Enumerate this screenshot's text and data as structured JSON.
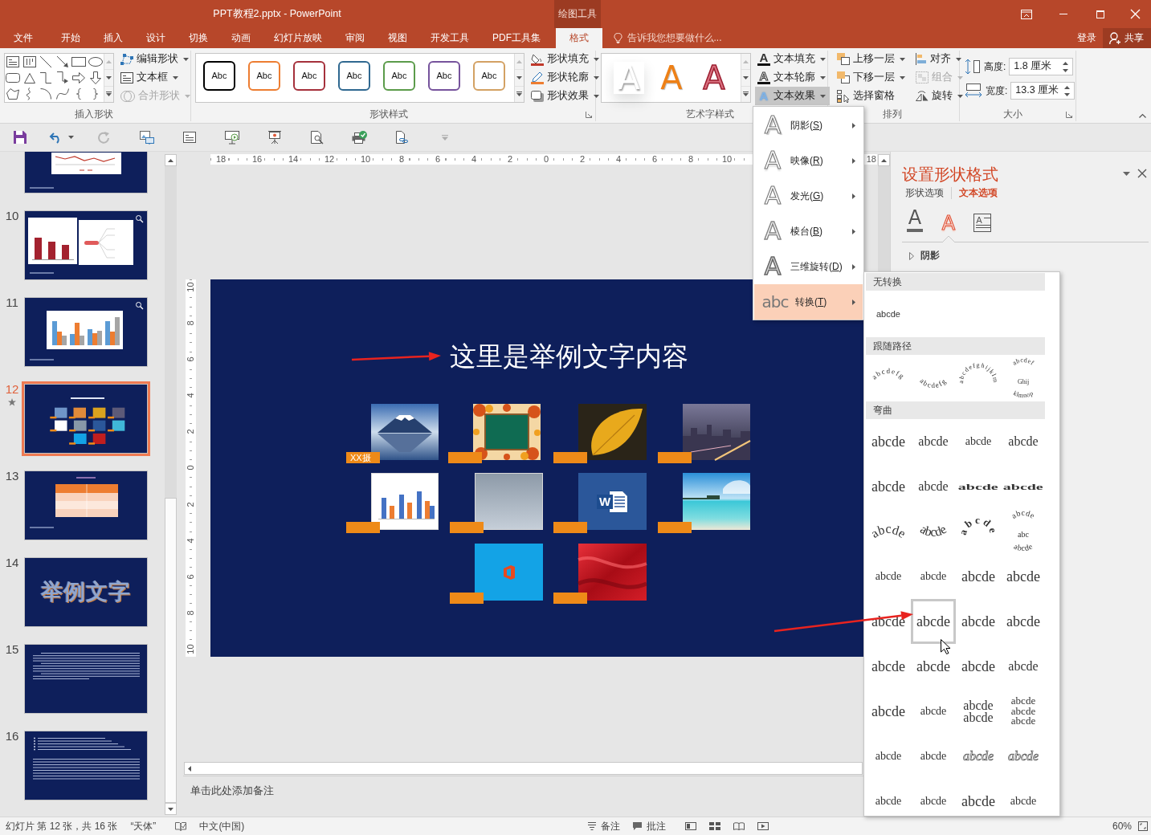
{
  "window": {
    "title": "PPT教程2.pptx - PowerPoint",
    "context_group": "绘图工具"
  },
  "ribbon_tabs": [
    {
      "label": "文件",
      "selected": false
    },
    {
      "label": "开始",
      "selected": false
    },
    {
      "label": "插入",
      "selected": false
    },
    {
      "label": "设计",
      "selected": false
    },
    {
      "label": "切换",
      "selected": false
    },
    {
      "label": "动画",
      "selected": false
    },
    {
      "label": "幻灯片放映",
      "selected": false
    },
    {
      "label": "审阅",
      "selected": false
    },
    {
      "label": "视图",
      "selected": false
    },
    {
      "label": "开发工具",
      "selected": false
    },
    {
      "label": "PDF工具集",
      "selected": false
    },
    {
      "label": "格式",
      "selected": true
    }
  ],
  "tell_me": {
    "placeholder": "告诉我您想要做什么..."
  },
  "account": {
    "sign_in": "登录",
    "share": "共享"
  },
  "ribbon_groups": [
    {
      "kind": "insert_shapes",
      "label": "插入形状",
      "launcher": false,
      "commands": [
        {
          "label": "编辑形状",
          "dropdown": true,
          "disabled": false
        },
        {
          "label": "文本框",
          "dropdown": true,
          "disabled": false
        },
        {
          "label": "合并形状",
          "dropdown": true,
          "disabled": true
        }
      ]
    },
    {
      "kind": "shape_styles",
      "label": "形状样式",
      "launcher": true,
      "presets": [
        {
          "text": "Abc",
          "color": "#000000"
        },
        {
          "text": "Abc",
          "color": "#ed7d31"
        },
        {
          "text": "Abc",
          "color": "#a5303b"
        },
        {
          "text": "Abc",
          "color": "#2f6890"
        },
        {
          "text": "Abc",
          "color": "#5b9b4a"
        },
        {
          "text": "Abc",
          "color": "#76539c"
        },
        {
          "text": "Abc",
          "color": "#d3a163"
        }
      ],
      "commands": [
        {
          "label": "形状填充",
          "dropdown": true,
          "disabled": false
        },
        {
          "label": "形状轮廓",
          "dropdown": true,
          "disabled": false
        },
        {
          "label": "形状效果",
          "dropdown": true,
          "disabled": false
        }
      ]
    },
    {
      "kind": "wordart_styles",
      "label": "艺术字样式",
      "launcher": false,
      "presets": [
        {
          "text": "A",
          "kind": "shadow",
          "color": "#ffffff"
        },
        {
          "text": "A",
          "kind": "solid",
          "color": "#ee8016"
        },
        {
          "text": "A",
          "kind": "outline",
          "color": "#d9707f"
        }
      ],
      "commands": [
        {
          "label": "文本填充",
          "icon_text": "A",
          "dropdown": true,
          "pressed": false
        },
        {
          "label": "文本轮廓",
          "icon_text": "A",
          "dropdown": true,
          "pressed": false
        },
        {
          "label": "文本效果",
          "icon_text": "A",
          "dropdown": true,
          "pressed": true
        }
      ]
    },
    {
      "kind": "arrange",
      "label": "排列",
      "launcher": false,
      "commands": [
        {
          "label": "上移一层",
          "dropdown": true,
          "disabled": false
        },
        {
          "label": "下移一层",
          "dropdown": true,
          "disabled": false
        },
        {
          "label": "选择窗格",
          "dropdown": false,
          "disabled": false
        },
        {
          "label": "对齐",
          "dropdown": true,
          "disabled": false
        },
        {
          "label": "组合",
          "dropdown": true,
          "disabled": true
        },
        {
          "label": "旋转",
          "dropdown": true,
          "disabled": false
        }
      ]
    },
    {
      "kind": "size",
      "label": "大小",
      "launcher": true,
      "fields": [
        {
          "label": "高度:",
          "value": "1.8 厘米"
        },
        {
          "label": "宽度:",
          "value": "13.3 厘米"
        }
      ]
    }
  ],
  "quick_access": [
    {
      "kind": "save",
      "disabled": false,
      "dropdown": false
    },
    {
      "kind": "undo",
      "disabled": false,
      "dropdown": true
    },
    {
      "kind": "redo",
      "disabled": true,
      "dropdown": false
    },
    {
      "kind": "picture",
      "disabled": false,
      "dropdown": false
    },
    {
      "kind": "textbox",
      "disabled": false,
      "dropdown": false
    },
    {
      "kind": "presenter",
      "disabled": false,
      "dropdown": false
    },
    {
      "kind": "screen",
      "disabled": false,
      "dropdown": false
    },
    {
      "kind": "preview",
      "disabled": false,
      "dropdown": false
    },
    {
      "kind": "print",
      "disabled": false,
      "dropdown": false
    },
    {
      "kind": "link",
      "disabled": false,
      "dropdown": false
    },
    {
      "kind": "customize",
      "disabled": true,
      "dropdown": false
    }
  ],
  "slides": [
    {
      "kind": "line-chart",
      "selected": false,
      "animated": false,
      "zoom_badge": false
    },
    {
      "number": "10",
      "kind": "charts",
      "selected": false,
      "animated": false,
      "zoom_badge": true
    },
    {
      "number": "11",
      "kind": "bar-chart",
      "selected": false,
      "animated": false,
      "zoom_badge": true
    },
    {
      "number": "12",
      "kind": "pictures",
      "selected": true,
      "animated": true,
      "zoom_badge": false
    },
    {
      "number": "13",
      "kind": "table",
      "selected": false,
      "animated": false,
      "zoom_badge": false
    },
    {
      "number": "14",
      "kind": "title",
      "title": "举例文字",
      "selected": false,
      "animated": false,
      "zoom_badge": false
    },
    {
      "number": "15",
      "kind": "text",
      "selected": false,
      "animated": false,
      "zoom_badge": false
    },
    {
      "number": "16",
      "kind": "bullets",
      "selected": false,
      "animated": false,
      "zoom_badge": false
    }
  ],
  "horizontal_ruler": {
    "labels": [
      "18",
      "16",
      "14",
      "12",
      "10",
      "8",
      "6",
      "4",
      "2",
      "0",
      "2",
      "4",
      "6",
      "8",
      "10"
    ],
    "end_label": "18"
  },
  "vertical_ruler": {
    "labels": [
      "10",
      "8",
      "6",
      "4",
      "2",
      "0",
      "2",
      "4",
      "6",
      "8",
      "10"
    ]
  },
  "slide": {
    "title": "这里是举例文字内容",
    "pictures": [
      {
        "kind": "mountain",
        "tag": "XX摄"
      },
      {
        "kind": "blackboard"
      },
      {
        "kind": "leaf"
      },
      {
        "kind": "city"
      },
      {
        "kind": "chart"
      },
      {
        "kind": "person"
      },
      {
        "kind": "document",
        "letter": "W"
      },
      {
        "kind": "beach"
      },
      {
        "kind": "logo"
      },
      {
        "kind": "fabric"
      }
    ]
  },
  "notes": {
    "placeholder": "单击此处添加备注"
  },
  "format_pane": {
    "title": "设置形状格式",
    "tabs": [
      {
        "label": "形状选项",
        "selected": false
      },
      {
        "label": "文本选项",
        "selected": true
      }
    ],
    "icon_tabs": [
      {
        "kind": "fill",
        "icon_text": "A",
        "selected": false
      },
      {
        "kind": "effects",
        "icon_text": "A",
        "selected": true
      },
      {
        "kind": "textbox",
        "icon_text": "A",
        "selected": false
      }
    ],
    "sections": [
      {
        "label": "阴影",
        "expanded": false
      }
    ]
  },
  "text_effects_menu": [
    {
      "kind": "shadow",
      "icon_text": "A",
      "label_before": "阴影(",
      "key": "S",
      "label_after": ")",
      "expanded": false
    },
    {
      "kind": "reflection",
      "icon_text": "A",
      "label_before": "映像(",
      "key": "R",
      "label_after": ")",
      "expanded": false
    },
    {
      "kind": "glow",
      "icon_text": "A",
      "label_before": "发光(",
      "key": "G",
      "label_after": ")",
      "expanded": false
    },
    {
      "kind": "bevel",
      "icon_text": "A",
      "label_before": "棱台(",
      "key": "B",
      "label_after": ")",
      "expanded": false
    },
    {
      "kind": "rotation",
      "icon_text": "A",
      "label_before": "三维旋转(",
      "key": "D",
      "label_after": ")",
      "expanded": false
    },
    {
      "kind": "transform",
      "icon_text": "abc",
      "label_before": "转换(",
      "key": "T",
      "label_after": ")",
      "expanded": true
    }
  ],
  "transform_gallery": [
    {
      "title": "无转换",
      "items": [
        {
          "kind": "label",
          "text": "abcde",
          "selected": false
        }
      ]
    },
    {
      "title": "跟随路径",
      "items": [
        {
          "kind": "arc-up",
          "text": "abcdefg",
          "selected": false
        },
        {
          "kind": "arc-down",
          "text": "abcdefg",
          "selected": false
        },
        {
          "kind": "circle",
          "text": "abcdefghijklm",
          "selected": false
        },
        {
          "kind": "button",
          "lines": [
            "abcdef",
            "Ghij",
            "klmnop"
          ],
          "selected": false
        }
      ]
    },
    {
      "title": "弯曲",
      "items": [
        {
          "kind": "plain",
          "text": "abcde",
          "selected": false
        },
        {
          "kind": "wave",
          "text": "abcde",
          "selected": false
        },
        {
          "kind": "small",
          "text": "abcde",
          "selected": false
        },
        {
          "kind": "wave",
          "text": "abcde",
          "selected": false
        },
        {
          "kind": "plain",
          "text": "abcde",
          "selected": false
        },
        {
          "kind": "wave",
          "text": "abcde",
          "selected": false
        },
        {
          "kind": "squash",
          "text": "abcde",
          "selected": false
        },
        {
          "kind": "squash",
          "text": "abcde",
          "selected": false
        },
        {
          "kind": "arc-up",
          "text": "abcde",
          "selected": false
        },
        {
          "kind": "arc-down",
          "text": "abcde",
          "selected": false
        },
        {
          "kind": "ring",
          "text": "abcde",
          "selected": false
        },
        {
          "kind": "button",
          "lines": [
            "abcde",
            "abc",
            "abcde"
          ],
          "selected": false
        },
        {
          "kind": "small",
          "text": "abcde",
          "selected": false
        },
        {
          "kind": "small",
          "text": "abcde",
          "selected": false
        },
        {
          "kind": "plain",
          "text": "abcde",
          "selected": false
        },
        {
          "kind": "plain",
          "text": "abcde",
          "selected": false
        },
        {
          "kind": "plain",
          "text": "abcde",
          "selected": false
        },
        {
          "kind": "plain",
          "text": "abcde",
          "selected": true
        },
        {
          "kind": "plain",
          "text": "abcde",
          "selected": false
        },
        {
          "kind": "plain",
          "text": "abcde",
          "selected": false
        },
        {
          "kind": "plain",
          "text": "abcde",
          "selected": false
        },
        {
          "kind": "plain",
          "text": "abcde",
          "selected": false
        },
        {
          "kind": "plain",
          "text": "abcde",
          "selected": false
        },
        {
          "kind": "wave",
          "text": "abcde",
          "selected": false
        },
        {
          "kind": "plain",
          "text": "abcde",
          "selected": false
        },
        {
          "kind": "small",
          "text": "abcde",
          "selected": false
        },
        {
          "kind": "stack",
          "lines": [
            "abcde",
            "abcde"
          ],
          "selected": false
        },
        {
          "kind": "stack",
          "lines": [
            "abcde",
            "abcde",
            "abcde"
          ],
          "selected": false
        },
        {
          "kind": "small",
          "text": "abcde",
          "selected": false
        },
        {
          "kind": "small",
          "text": "abcde",
          "selected": false
        },
        {
          "kind": "slant",
          "text": "abcde",
          "selected": false
        },
        {
          "kind": "slant",
          "text": "abcde",
          "selected": false
        },
        {
          "kind": "small",
          "text": "abcde",
          "selected": false
        },
        {
          "kind": "small",
          "text": "abcde",
          "selected": false
        },
        {
          "kind": "plain",
          "text": "abcde",
          "selected": false
        },
        {
          "kind": "small",
          "text": "abcde",
          "selected": false
        }
      ]
    }
  ],
  "annotations": [
    {
      "kind": "arrow"
    },
    {
      "kind": "arrow"
    }
  ],
  "status_bar": {
    "slide_info": "幻灯片 第 12 张，共 16 张",
    "theme": "“天体”",
    "language": "中文(中国)",
    "notes": "备注",
    "comments": "批注",
    "zoom": "60%"
  }
}
